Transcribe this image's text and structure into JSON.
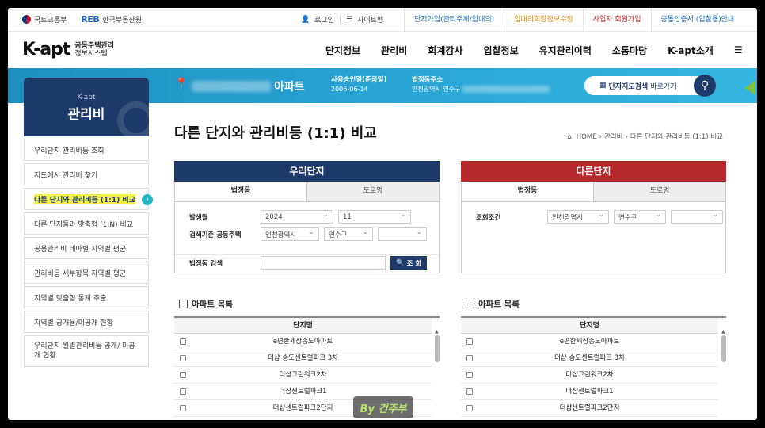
{
  "topbar": {
    "gov_logo": "국토교통부",
    "reb_mark": "REB",
    "reb_logo": "한국부동산원",
    "login": "로그인",
    "sitemap": "사이트맵",
    "menu": [
      {
        "label": "단지가입(관리주체/입대의)",
        "color": "blue"
      },
      {
        "label": "입대의회장정보수정",
        "color": "orange"
      },
      {
        "label": "사업자 회원가입",
        "color": "red"
      },
      {
        "label": "공동인증서 (입찰용)안내",
        "color": "blue"
      }
    ]
  },
  "header": {
    "brand": "K-apt",
    "brand_sub1": "공동주택관리",
    "brand_sub2": "정보시스템",
    "nav": [
      "단지정보",
      "관리비",
      "회계감사",
      "입찰정보",
      "유지관리이력",
      "소통마당",
      "K-apt소개"
    ],
    "menu_icon": "hamburger-icon"
  },
  "band": {
    "apt_suffix": "아파트",
    "approval_label": "사용승인일(준공일)",
    "approval_date": "2006-06-14",
    "address_label": "법정동주소",
    "address_value": "인천광역시 연수구",
    "map_button_bold": "단지지도검색",
    "map_button_rest": "바로가기"
  },
  "sidebar": {
    "brand": "K-apt",
    "title": "관리비",
    "items": [
      {
        "label": "우리단지 관리비등 조회"
      },
      {
        "label": "지도에서 관리비 찾기"
      },
      {
        "label": "다른 단지와 관리비등 (1:1) 비교",
        "active": true
      },
      {
        "label": "다른 단지들과 맞춤형 (1:N) 비교"
      },
      {
        "label": "공용관리비 테마별 지역별 평균"
      },
      {
        "label": "관리비등 세부항목 지역별 평균"
      },
      {
        "label": "지역별 맞춤형 통계 추출"
      },
      {
        "label": "지역별 공개율/미공개 현황"
      },
      {
        "label": "우리단지 월별관리비등 공개/ 미공개 현황"
      }
    ]
  },
  "page": {
    "title": "다른 단지와 관리비등 (1:1) 비교",
    "breadcrumb": [
      "HOME",
      "관리비",
      "다른 단지와 관리비등 (1:1) 비교"
    ]
  },
  "our": {
    "title": "우리단지",
    "color": "#1d3a6b",
    "tab_active": "법정동",
    "tab_other": "도로명",
    "period_label": "발생월",
    "year": "2024",
    "month": "11",
    "criteria_label": "검색기준 공동주택",
    "sido": "인천광역시",
    "gu": "연수구",
    "search_label": "법정동 검색",
    "search_button": "조 회",
    "list_title": "아파트 목록",
    "col_header": "단지명",
    "rows": [
      "e편한세상송도아파트",
      "더샵 송도센트럴파크 3차",
      "더샵그린워크2차",
      "더샵센트럴파크1",
      "더샵센트럴파크2단지"
    ]
  },
  "other": {
    "title": "다른단지",
    "color": "#b5282b",
    "tab_active": "법정동",
    "tab_other": "도로명",
    "cond_label": "조회조건",
    "sido": "인천광역시",
    "gu": "연수구",
    "list_title": "아파트 목록",
    "col_header": "단지명",
    "rows": [
      "e편한세상송도아파트",
      "더샵 송도센트럴파크 3차",
      "더샵그린워크2차",
      "더샵센트럴파크1",
      "더샵센트럴파크2단지"
    ]
  },
  "watermark": "By 건주부"
}
